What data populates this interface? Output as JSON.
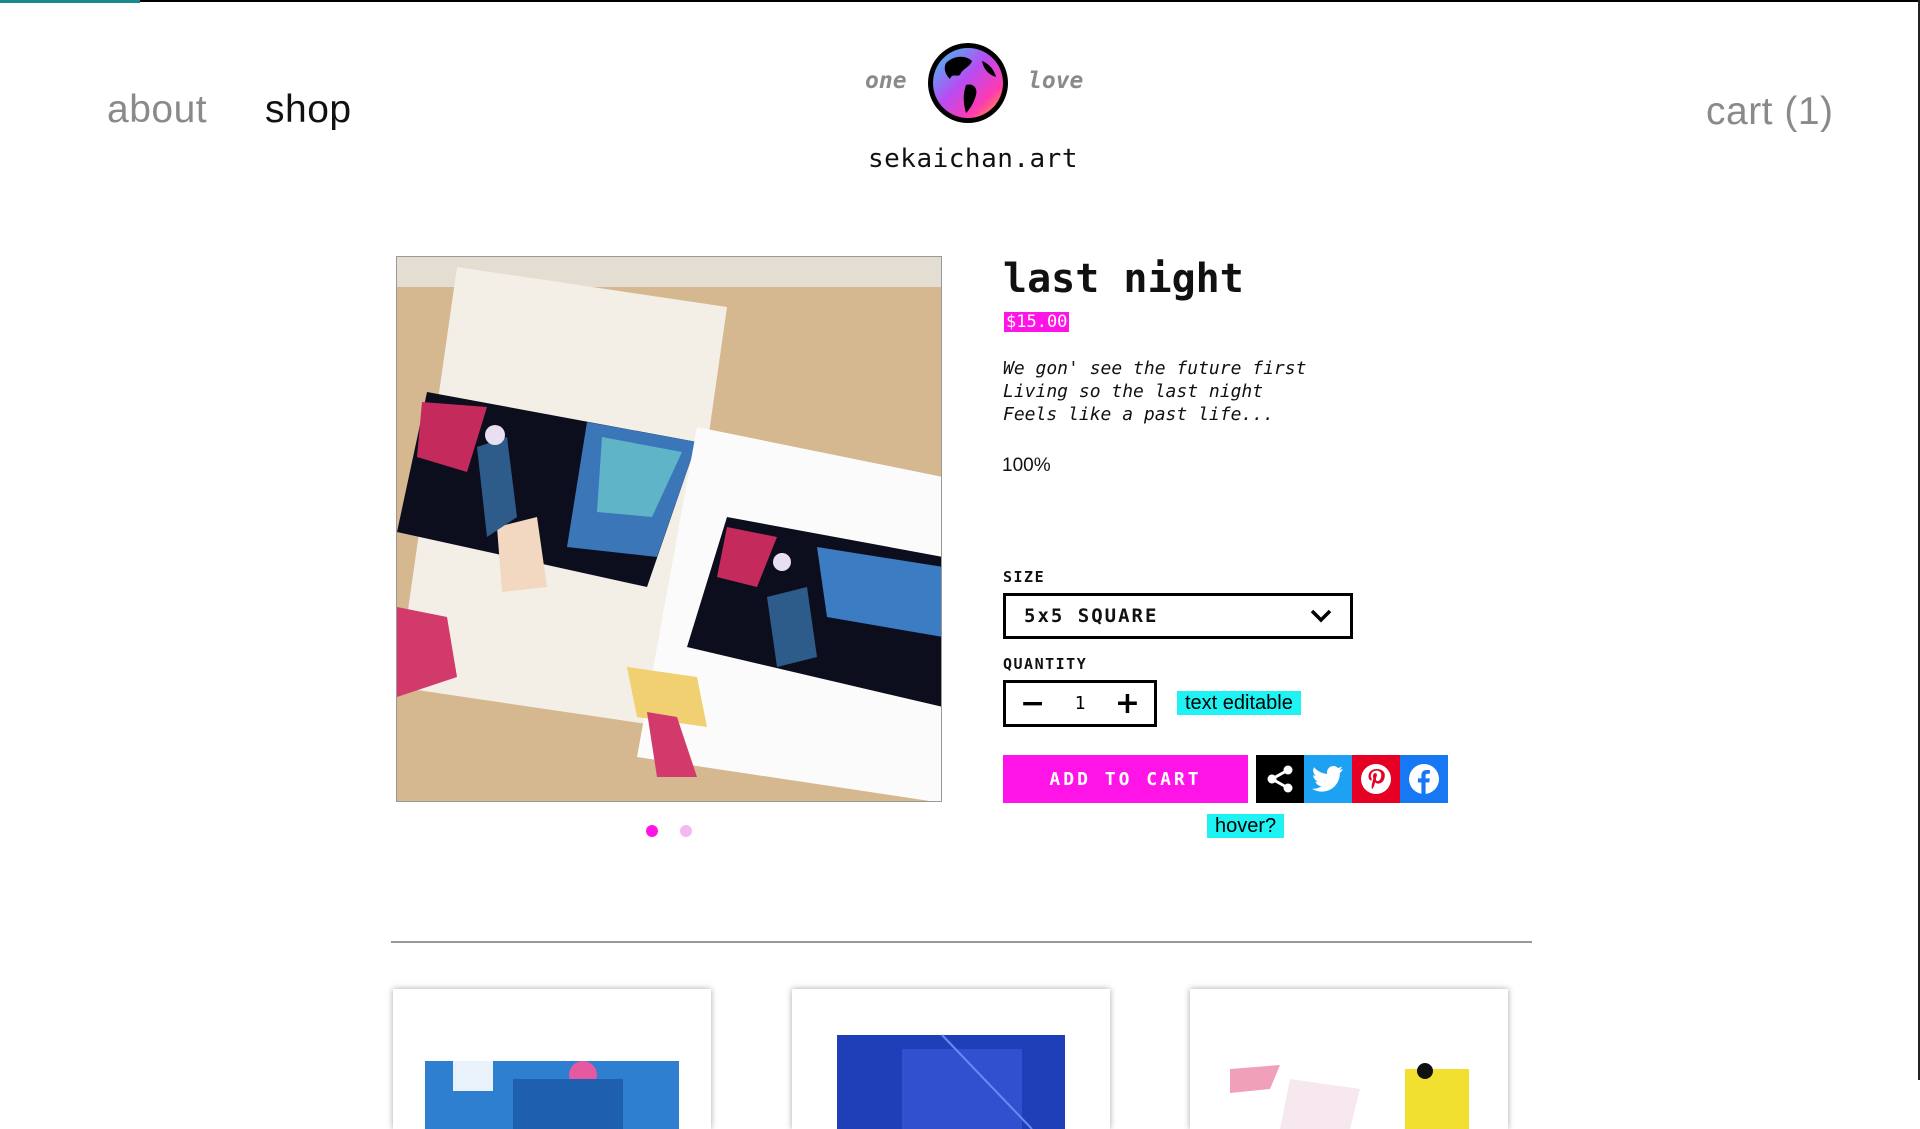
{
  "header": {
    "nav": {
      "about": "about",
      "shop": "shop"
    },
    "cart_label": "cart (1)",
    "brand": {
      "left_word": "one",
      "right_word": "love",
      "name": "sekaichan.art",
      "logo_icon": "globe-icon"
    }
  },
  "product": {
    "title": "last night",
    "price": "$15.00",
    "description": [
      "We gon' see the future first",
      "Living so the last night",
      "Feels like a past life..."
    ],
    "percent": "100%",
    "size": {
      "label": "SIZE",
      "selected": "5x5 SQUARE"
    },
    "quantity": {
      "label": "QUANTITY",
      "value": "1"
    },
    "add_to_cart_label": "ADD TO CART",
    "image_dots": {
      "count": 2,
      "active_index": 0
    },
    "editor_tags": {
      "editable": "text editable",
      "hover": "hover?"
    }
  },
  "share": {
    "icons": [
      "share-icon",
      "twitter-icon",
      "pinterest-icon",
      "facebook-icon"
    ]
  },
  "related": {
    "cards": [
      "card-1",
      "card-2",
      "card-3"
    ]
  },
  "colors": {
    "accent_magenta": "#ff14e8",
    "dot_inactive": "#f4b8f0",
    "tag_cyan": "#1ef2f2",
    "twitter": "#1da1f2",
    "pinterest": "#e60023",
    "facebook": "#1877f2",
    "share_black": "#000000"
  }
}
